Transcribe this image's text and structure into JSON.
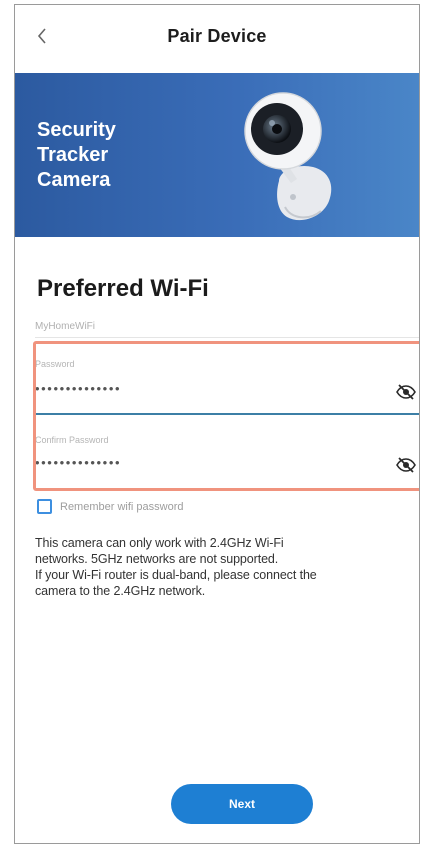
{
  "header": {
    "title": "Pair Device"
  },
  "banner": {
    "line1": "Security",
    "line2": "Tracker",
    "line3": "Camera",
    "gradient_start": "#2c5aa0",
    "gradient_end": "#4a86c8"
  },
  "form": {
    "section_title": "Preferred Wi-Fi",
    "ssid": "MyHomeWiFi",
    "password": {
      "label": "Password",
      "value": "••••••••••••••",
      "icon": "eye-off-icon"
    },
    "confirm_password": {
      "label": "Confirm Password",
      "value": "••••••••••••••",
      "icon": "eye-off-icon"
    },
    "remember": {
      "label": "Remember wifi password",
      "checked": false
    }
  },
  "info": {
    "line1": "This camera can only work with 2.4GHz Wi-Fi",
    "line2": "networks. 5GHz networks are not supported.",
    "line3": "If your Wi-Fi router is dual-band, please connect the",
    "line4": "camera to the 2.4GHz network."
  },
  "actions": {
    "next_label": "Next"
  },
  "colors": {
    "accent": "#1e7fd3",
    "highlight": "#f0937e",
    "field_line": "#3c7fa6"
  }
}
